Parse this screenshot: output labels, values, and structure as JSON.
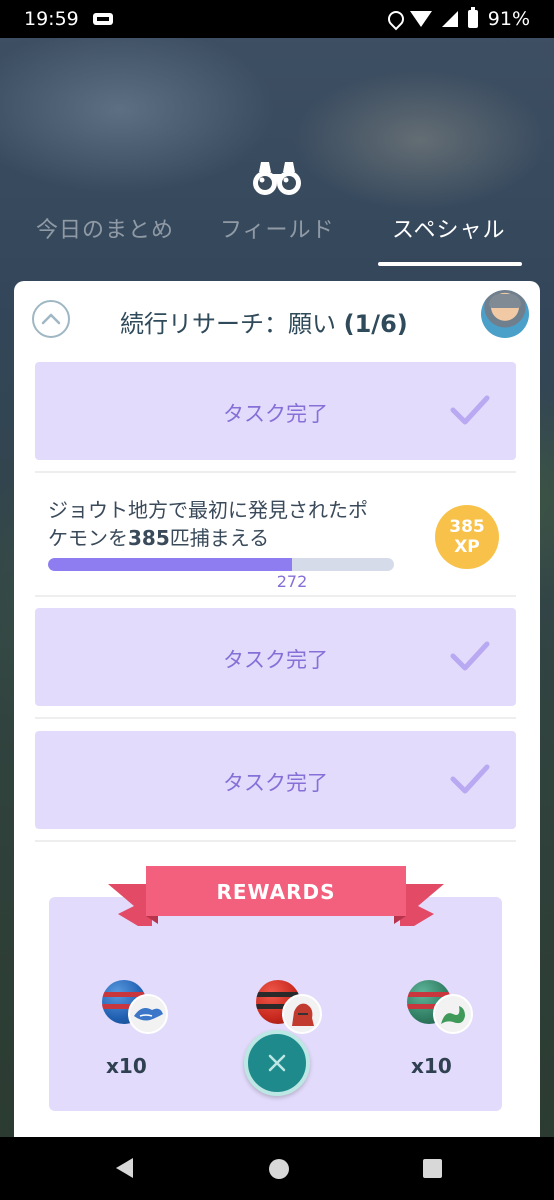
{
  "status_bar": {
    "time": "19:59",
    "battery": "91%"
  },
  "tabs": [
    {
      "label": "今日のまとめ",
      "active": false
    },
    {
      "label": "フィールド",
      "active": false
    },
    {
      "label": "スペシャル",
      "active": true
    }
  ],
  "research": {
    "title_prefix": "続行リサーチ：願い",
    "title_count": "(1/6)",
    "tasks": [
      {
        "state": "done",
        "label": "タスク完了"
      },
      {
        "state": "active",
        "text_1": "ジョウト地方で最初に発見されたポ",
        "text_2a": "ケモンを",
        "text_2b": "385",
        "text_2c": "匹捕まえる",
        "progress_value": 272,
        "progress_goal": 385,
        "progress_label": "272",
        "reward_xp": "385",
        "reward_unit": "XP"
      },
      {
        "state": "done",
        "label": "タスク完了"
      },
      {
        "state": "done",
        "label": "タスク完了"
      }
    ]
  },
  "rewards": {
    "banner": "REWARDS",
    "items": [
      {
        "icon": "blue-encounter-ball-icon",
        "qty": "x10"
      },
      {
        "icon": "red-encounter-ball-icon",
        "qty": ""
      },
      {
        "icon": "green-encounter-ball-icon",
        "qty": "x10"
      }
    ]
  },
  "colors": {
    "accent_purple": "#8670d8",
    "task_bg": "#e2dbfb",
    "xp_badge": "#f8c24a",
    "ribbon": "#f2607e",
    "close_button": "#1f8a8c"
  }
}
